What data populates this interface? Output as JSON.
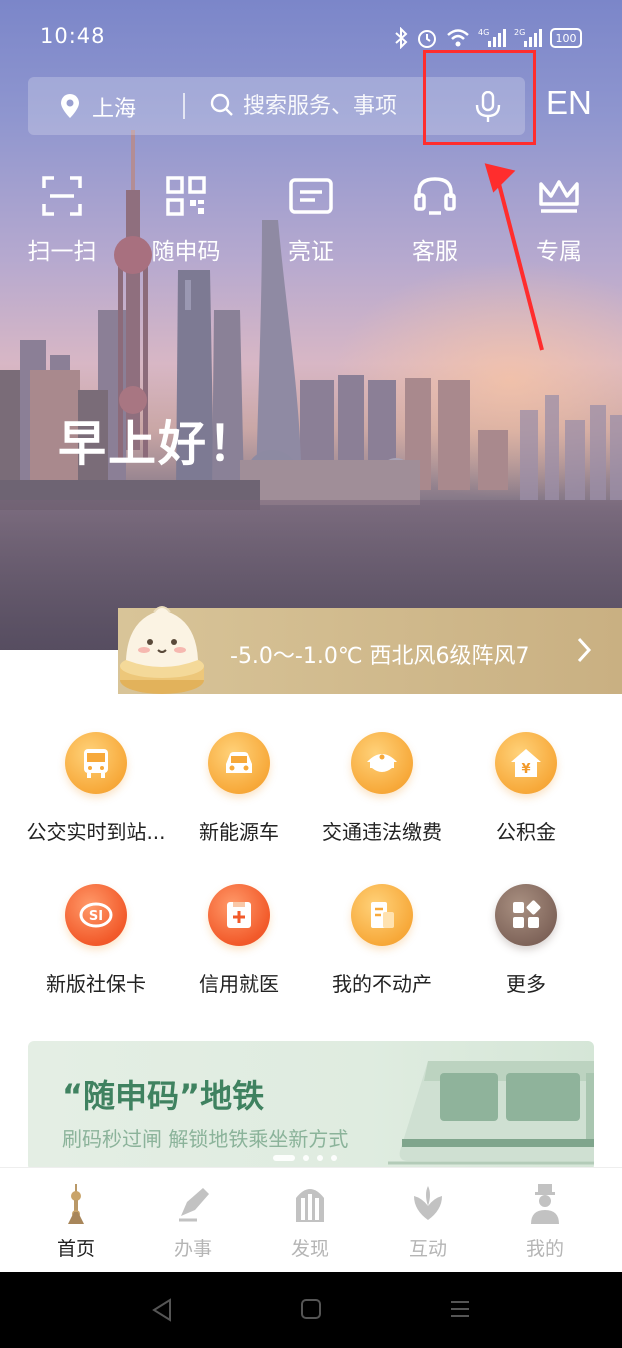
{
  "status_bar": {
    "time": "10:48",
    "battery": "100",
    "net1": "4G",
    "net2": "2G"
  },
  "search": {
    "location": "上海",
    "placeholder": "搜索服务、事项"
  },
  "language_button": "EN",
  "quick_actions": [
    {
      "label": "扫一扫",
      "icon": "scan-icon"
    },
    {
      "label": "随申码",
      "icon": "qr-code-icon"
    },
    {
      "label": "亮证",
      "icon": "id-card-icon"
    },
    {
      "label": "客服",
      "icon": "headset-icon"
    },
    {
      "label": "专属",
      "icon": "crown-icon"
    }
  ],
  "greeting": "早上好！",
  "weather": {
    "text": "-5.0～-1.0℃ 西北风6级阵风7"
  },
  "services": [
    {
      "label": "公交实时到站...",
      "icon": "bus-icon"
    },
    {
      "label": "新能源车",
      "icon": "car-icon"
    },
    {
      "label": "交通违法缴费",
      "icon": "police-cap-icon"
    },
    {
      "label": "公积金",
      "icon": "housing-fund-icon"
    },
    {
      "label": "新版社保卡",
      "icon": "social-security-icon"
    },
    {
      "label": "信用就医",
      "icon": "medical-icon"
    },
    {
      "label": "我的不动产",
      "icon": "property-icon"
    },
    {
      "label": "更多",
      "icon": "more-grid-icon"
    }
  ],
  "banner": {
    "title": "“随申码”地铁",
    "subtitle": "刷码秒过闸 解锁地铁乘坐新方式"
  },
  "tabs": [
    {
      "label": "首页",
      "icon": "home-tower-icon",
      "active": true
    },
    {
      "label": "办事",
      "icon": "pen-icon",
      "active": false
    },
    {
      "label": "发现",
      "icon": "discover-icon",
      "active": false
    },
    {
      "label": "互动",
      "icon": "interact-icon",
      "active": false
    },
    {
      "label": "我的",
      "icon": "profile-icon",
      "active": false
    }
  ],
  "colors": {
    "accent_orange": "#f7a93a",
    "highlight_red": "#ff2d2d",
    "banner_green": "#3f8260",
    "weather_gold": "#d8c498"
  }
}
